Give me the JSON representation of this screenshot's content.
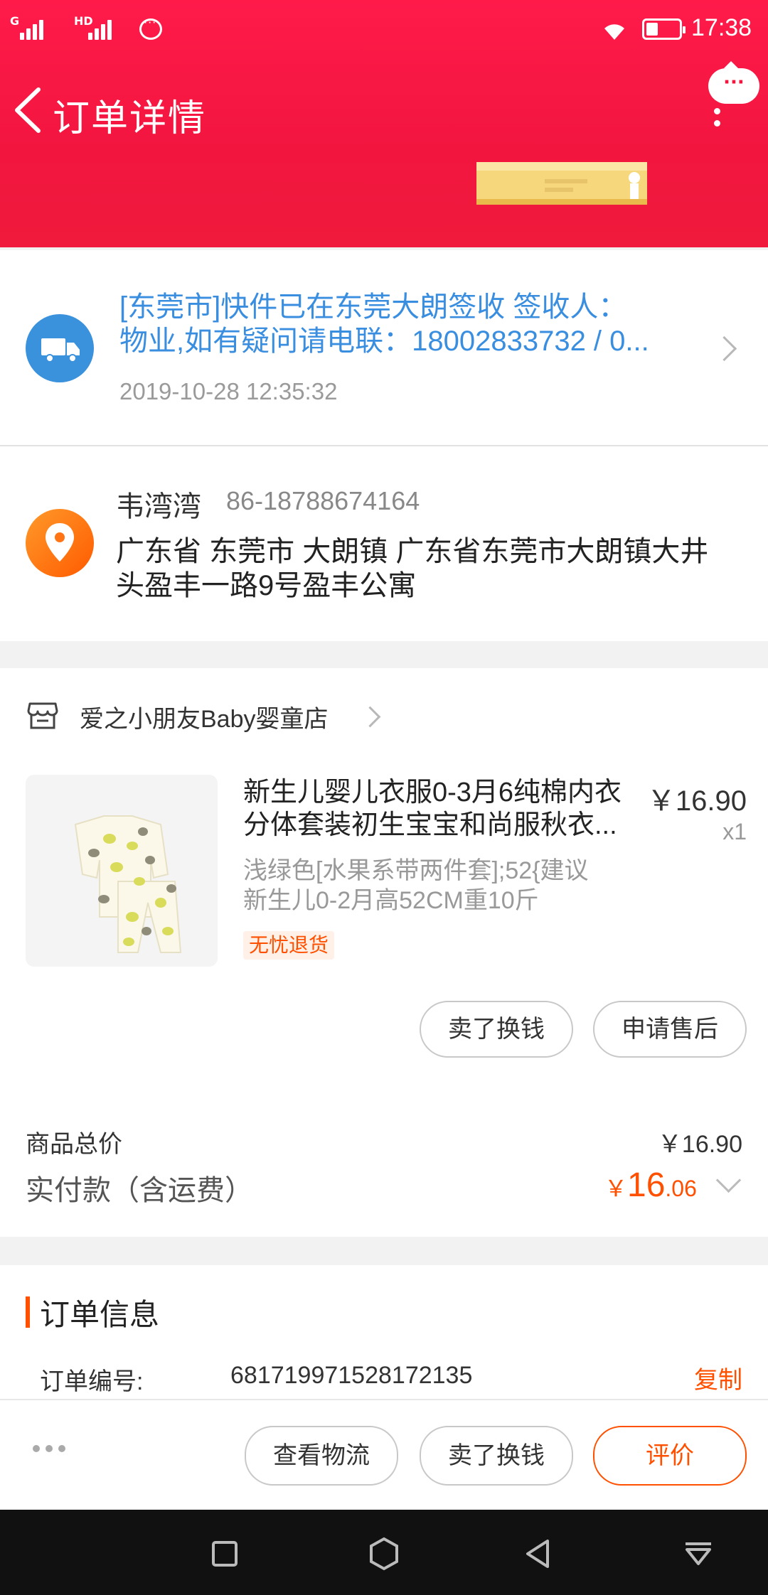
{
  "status_bar": {
    "network_1": "G",
    "network_2": "HD",
    "time": "17:38"
  },
  "header": {
    "title": "订单详情",
    "bubble_text": "···"
  },
  "logistics": {
    "line1": "[东莞市]快件已在东莞大朗签收 签收人：",
    "line2": "物业,如有疑问请电联：18002833732 / 0...",
    "time": "2019-10-28 12:35:32",
    "icon": "truck-icon"
  },
  "address": {
    "name": "韦湾湾",
    "phone": "86-18788674164",
    "line1": "广东省 东莞市 大朗镇 广东省东莞市大朗镇大井",
    "line2": "头盈丰一路9号盈丰公寓",
    "icon": "location-pin-icon"
  },
  "store": {
    "name": "爱之小朋友Baby婴童店"
  },
  "product": {
    "title_line1": "新生儿婴儿衣服0-3月6纯棉内衣",
    "title_line2": "分体套装初生宝宝和尚服秋衣...",
    "price": "￥16.90",
    "quantity": "x1",
    "spec_line1": "浅绿色[水果系带两件套];52{建议",
    "spec_line2": "新生儿0-2月高52CM重10斤",
    "tag": "无忧退货"
  },
  "item_actions": {
    "sell": "卖了换钱",
    "after_sale": "申请售后"
  },
  "summary": {
    "total_label": "商品总价",
    "total_value": "￥16.90",
    "paid_label": "实付款（含运费）",
    "paid_currency": "￥",
    "paid_integer": "16",
    "paid_decimal": ".06"
  },
  "order_info": {
    "title": "订单信息",
    "number_label": "订单编号:",
    "number_value": "681719971528172135",
    "copy": "复制"
  },
  "action_bar": {
    "logistics": "查看物流",
    "sell": "卖了换钱",
    "review": "评价"
  },
  "colors": {
    "header_red": "#f2163f",
    "accent_orange": "#ff5000",
    "link_blue": "#3a8ee0"
  }
}
